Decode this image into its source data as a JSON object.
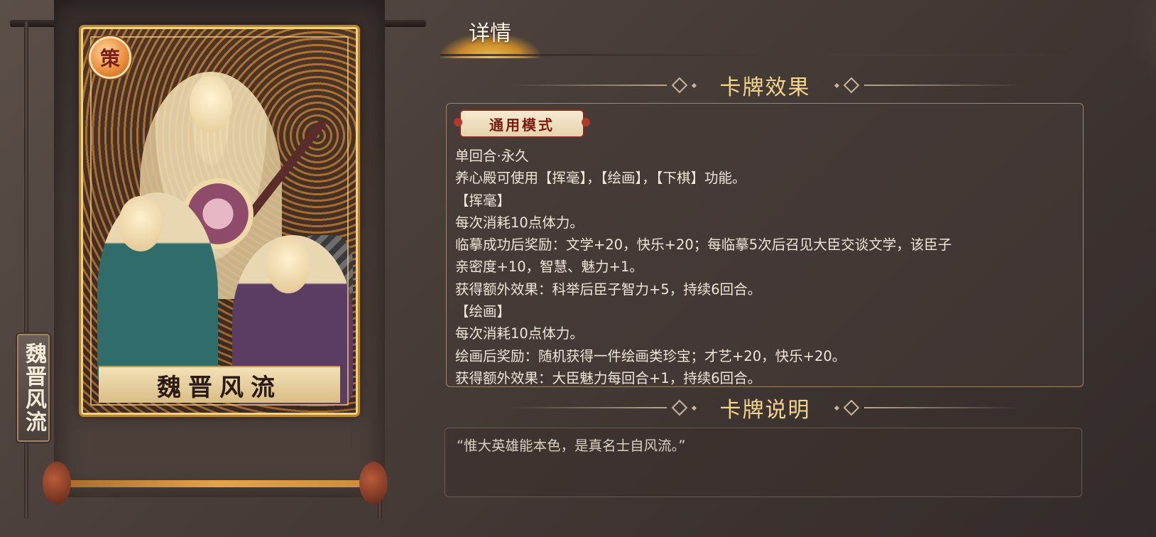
{
  "left_panel": {
    "vertical_title": "魏晋风流",
    "card": {
      "badge_glyph": "策",
      "name": "魏晋风流"
    }
  },
  "tabs": {
    "details_label": "详情"
  },
  "effect_section": {
    "title": "卡牌效果",
    "mode_tag": "通用模式",
    "lines": [
      "单回合·永久",
      "养心殿可使用【挥毫】，【绘画】，【下棋】功能。",
      "【挥毫】",
      "每次消耗10点体力。",
      "临摹成功后奖励：文学+20，快乐+20；每临摹5次后召见大臣交谈文学，该臣子",
      "亲密度+10，智慧、魅力+1。",
      "获得额外效果：科举后臣子智力+5，持续6回合。",
      "【绘画】",
      "每次消耗10点体力。",
      "绘画后奖励：随机获得一件绘画类珍宝；才艺+20，快乐+20。",
      "获得额外效果：大臣魅力每回合+1，持续6回合。"
    ]
  },
  "description_section": {
    "title": "卡牌说明",
    "text": "“惟大英雄能本色，是真名士自风流。”"
  },
  "colors": {
    "accent_gold": "#f4d58a",
    "card_frame": "#f2d27b",
    "mode_tag_red": "#7a1a12"
  }
}
